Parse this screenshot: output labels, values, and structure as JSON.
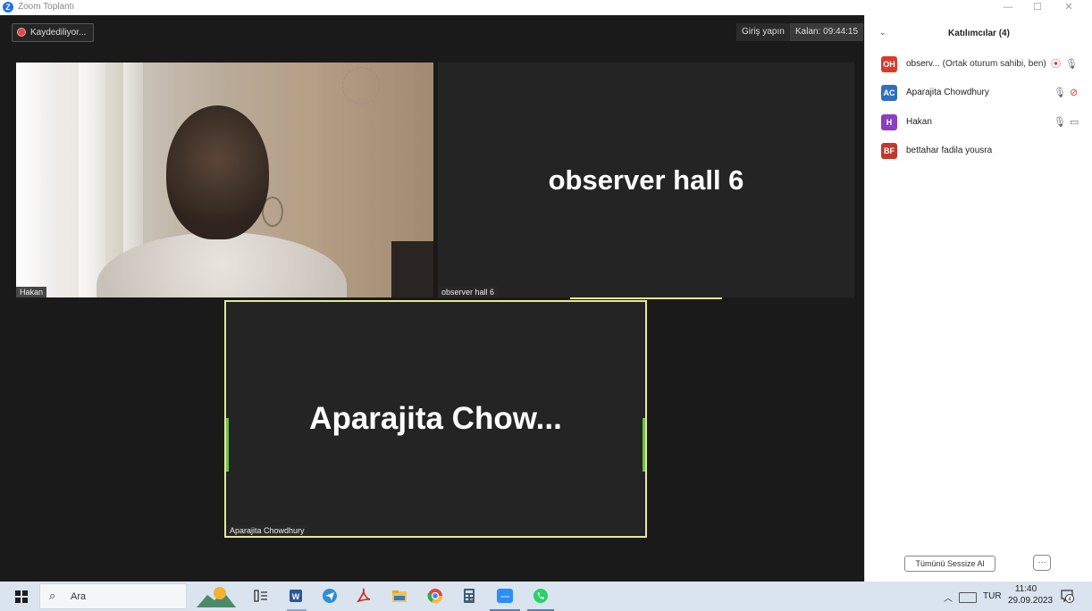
{
  "window": {
    "app_logo": "Z",
    "title": "Zoom Toplantı",
    "controls": {
      "minimize": "—",
      "maximize": "☐",
      "close": "✕"
    }
  },
  "meeting": {
    "recording_label": "Kaydediliyor...",
    "sign_in_label": "Giriş yapın",
    "remaining_label": "Kalan: 09:44:15"
  },
  "tiles": {
    "hakan": {
      "label": "Hakan"
    },
    "observer": {
      "label": "observer hall 6",
      "display_name": "observer hall 6"
    },
    "aparajita": {
      "label": "Aparajita Chowdhury",
      "display_name": "Aparajita  Chow..."
    }
  },
  "participants_panel": {
    "title": "Katılımcılar (4)",
    "participants": [
      {
        "initials": "OH",
        "name": "observ...",
        "suffix": "(Ortak oturum sahibi, ben)",
        "avatar_color": "#d93b2b"
      },
      {
        "initials": "AC",
        "name": "Aparajita Chowdhury",
        "suffix": "",
        "avatar_color": "#2f6fc1"
      },
      {
        "initials": "H",
        "name": "Hakan",
        "suffix": "",
        "avatar_color": "#8a3fbd"
      },
      {
        "initials": "BF",
        "name": "bettahar fadila yousra",
        "suffix": "",
        "avatar_color": "#c0392b"
      }
    ],
    "mute_all_label": "Tümünü Sessize Al",
    "more_label": "···"
  },
  "taskbar": {
    "search_placeholder": "Ara",
    "language": "TUR",
    "time": "11:40",
    "date": "29.09.2023",
    "notifications_count": "4"
  }
}
